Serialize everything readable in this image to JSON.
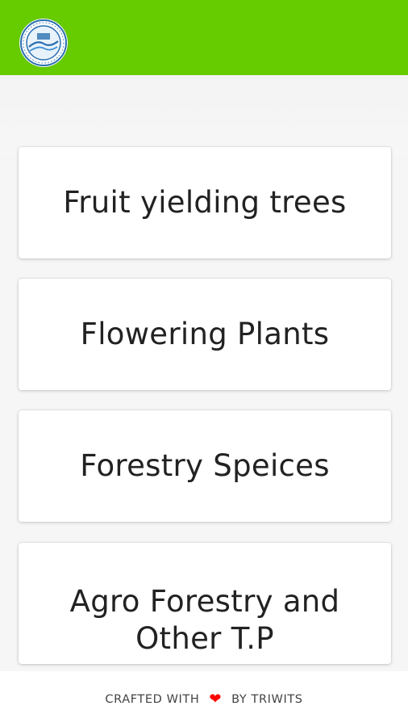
{
  "colors": {
    "brand": "#66cc00",
    "heart": "#ff0000"
  },
  "header": {
    "logo_icon": "emblem-logo"
  },
  "categories": [
    {
      "label": "Fruit yielding trees"
    },
    {
      "label": "Flowering Plants"
    },
    {
      "label": "Forestry Speices"
    },
    {
      "label": "Agro Forestry and Other T.P"
    }
  ],
  "footer": {
    "crafted_label": "CRAFTED WITH",
    "heart_icon": "heart-icon",
    "by_label": "BY TRIWITS"
  }
}
